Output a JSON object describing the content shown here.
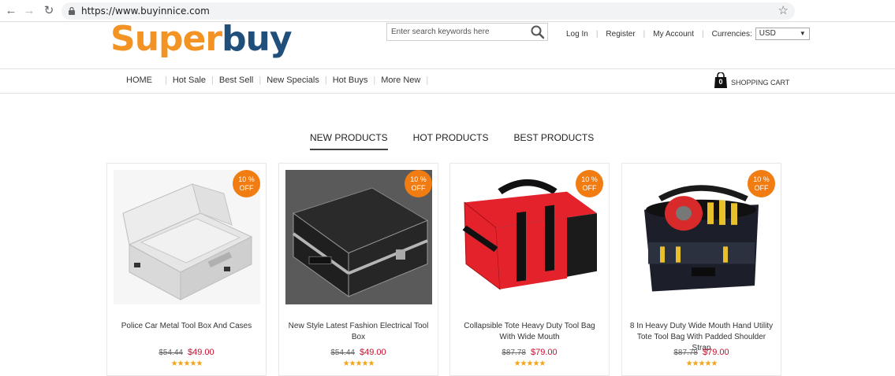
{
  "browser": {
    "url": "https://www.buyinnice.com"
  },
  "header": {
    "logo_part1": "Super",
    "logo_part2": "buy",
    "search_placeholder": "Enter search keywords here",
    "login": "Log In",
    "register": "Register",
    "my_account": "My Account",
    "currencies_label": "Currencies:",
    "currency_value": "USD"
  },
  "nav": {
    "items": [
      "HOME",
      "Hot Sale",
      "Best Sell",
      "New Specials",
      "Hot Buys",
      "More New"
    ],
    "cart_label": "SHOPPING CART",
    "cart_count": "0"
  },
  "tabs": [
    "NEW PRODUCTS",
    "HOT PRODUCTS",
    "BEST PRODUCTS"
  ],
  "products": [
    {
      "name": "Police Car Metal Tool Box And Cases",
      "old_price": "$54.44",
      "price": "$49.00",
      "badge_line1": "10 %",
      "badge_line2": "OFF",
      "stars": "★★★★★"
    },
    {
      "name": "New Style Latest Fashion Electrical Tool Box",
      "old_price": "$54.44",
      "price": "$49.00",
      "badge_line1": "10 %",
      "badge_line2": "OFF",
      "stars": "★★★★★"
    },
    {
      "name": "Collapsible Tote Heavy Duty Tool Bag With Wide Mouth",
      "old_price": "$87.78",
      "price": "$79.00",
      "badge_line1": "10 %",
      "badge_line2": "OFF",
      "stars": "★★★★★"
    },
    {
      "name": "8 In Heavy Duty Wide Mouth Hand Utility Tote Tool Bag With Padded Shoulder Strap",
      "old_price": "$87.78",
      "price": "$79.00",
      "badge_line1": "10 %",
      "badge_line2": "OFF",
      "stars": "★★★★★"
    }
  ],
  "colors": {
    "logo_orange": "#f39323",
    "logo_blue": "#1f4f7a",
    "badge": "#f07c12",
    "price_red": "#c8102e",
    "star_gold": "#f2a51a"
  }
}
